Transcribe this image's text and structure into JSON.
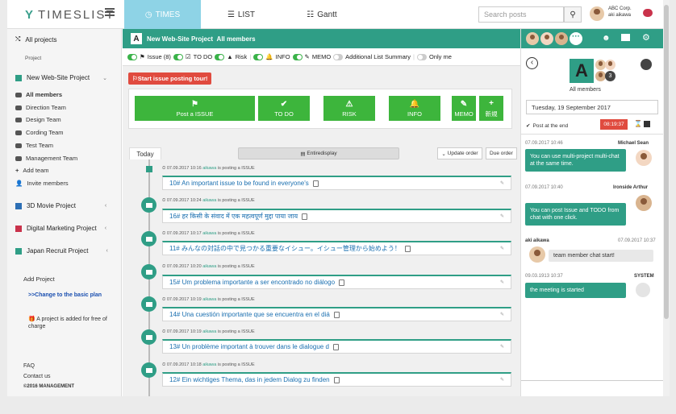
{
  "nav": {
    "logo_text": "TIMESLIST",
    "tabs": [
      {
        "label": "TIMES"
      },
      {
        "label": "LIST"
      },
      {
        "label": "Gantt"
      }
    ],
    "search_placeholder": "Search posts",
    "company": "ABC Corp.",
    "user": "aki aikawa"
  },
  "sidebar": {
    "all_projects": "All projects",
    "project_label": "Project",
    "projects": [
      {
        "name": "New Web-Site Project",
        "color": "#2f9e86",
        "active": true
      },
      {
        "name": "3D Movie Project",
        "color": "#2d6fb5"
      },
      {
        "name": "Digital Marketing Project",
        "color": "#c9324b"
      },
      {
        "name": "Japan Recruit Project",
        "color": "#2f9e86"
      }
    ],
    "teams": [
      "All members",
      "Direction Team",
      "Design Team",
      "Cording Team",
      "Test Team",
      "Management Team"
    ],
    "add_team": "Add team",
    "invite_members": "Invite members",
    "add_project": "Add Project",
    "change_plan": ">>Change to the basic plan",
    "free_note": "A project is added for free of charge",
    "faq": "FAQ",
    "contact": "Contact us",
    "copyright": "©2016 MANAGEMENT"
  },
  "main": {
    "project_letter": "A",
    "project_title": "New Web-Site Project",
    "project_members": "All members",
    "filters": {
      "issue": "Issue (8)",
      "todo": "TO DO",
      "risk": "Risk",
      "info": "INFO",
      "memo": "MEMO",
      "summary": "Additional List Summary",
      "only_me": "Only me"
    },
    "tour_button": "Start issue posting tour!",
    "actions": [
      {
        "label": "Post a ISSUE",
        "icon": "⚑"
      },
      {
        "label": "TO DO",
        "icon": "✔"
      },
      {
        "label": "RISK",
        "icon": "⚠"
      },
      {
        "label": "INFO",
        "icon": "🔔"
      },
      {
        "label": "MEMO",
        "icon": "✎"
      },
      {
        "label": "新規",
        "icon": "+"
      }
    ],
    "today_tab": "Today",
    "entire_display": "Entiredisplay",
    "update_order": "Update order",
    "due_order": "Due order",
    "posts": [
      {
        "date": "07.09.2017 10:16",
        "user": "aikawa",
        "action": "is posting a ISSUE",
        "title": "10# An important issue to be found in everyone's"
      },
      {
        "date": "07.09.2017 10:24",
        "user": "aikawa",
        "action": "is posting a ISSUE",
        "title": "16# हर किसी के संवाद में एक महत्वपूर्ण मुद्दा पाया जाय"
      },
      {
        "date": "07.09.2017 10:17",
        "user": "aikawa",
        "action": "is posting a ISSUE",
        "title": "11# みんなの対話の中で見つかる重要なイシュー。イシュー管理から始めよう！"
      },
      {
        "date": "07.09.2017 10:20",
        "user": "aikawa",
        "action": "is posting a ISSUE",
        "title": "15# Um problema importante a ser encontrado no diálogo"
      },
      {
        "date": "07.09.2017 10:19",
        "user": "aikawa",
        "action": "is posting a ISSUE",
        "title": "14# Una cuestión importante que se encuentra en el diá"
      },
      {
        "date": "07.09.2017 10:19",
        "user": "aikawa",
        "action": "is posting a ISSUE",
        "title": "13# Un problème important à trouver dans le dialogue d"
      },
      {
        "date": "07.09.2017 10:18",
        "user": "aikawa",
        "action": "is posting a ISSUE",
        "title": "12# Ein wichtiges Thema, das in jedem Dialog zu finden"
      }
    ]
  },
  "right": {
    "group_letter": "A",
    "group_name": "All members",
    "date": "Tuesday, 19 September 2017",
    "post_at_end": "Post at the end",
    "timer": "08:19:37",
    "messages": [
      {
        "date": "07.09.2017 10:46",
        "user": "Michael Sean",
        "text": "You can use multi-project multi-chat at the same time."
      },
      {
        "date": "07.09.2017 10:40",
        "user": "Ironside Arthur",
        "text": "You can post Issue and TODO from chat with one click."
      },
      {
        "date": "07.09.2017 10:37",
        "user": "aki aikawa",
        "text": "team member chat start!"
      },
      {
        "date": "09.03.1913 10:37",
        "user": "SYSTEM",
        "text": "the meeting is started"
      }
    ]
  },
  "colors": {
    "accent": "#2f9e86",
    "action_green": "#3db53c",
    "tour_red": "#e04b3f",
    "tab_active": "#8ed3e6"
  }
}
